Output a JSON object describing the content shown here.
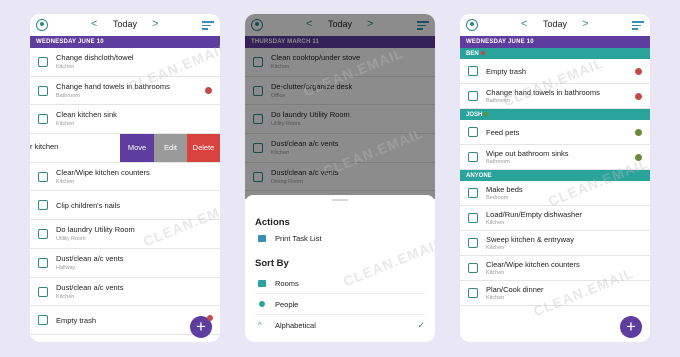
{
  "watermark": "CLEAN.EMAIL",
  "phone1": {
    "nav": {
      "prev": "<",
      "title": "Today",
      "next": ">"
    },
    "date": "WEDNESDAY JUNE 10",
    "tasks_before": [
      {
        "name": "Change dishcloth/towel",
        "room": "Kitchen"
      },
      {
        "name": "Change hand towels in bathrooms",
        "room": "Bathroom"
      },
      {
        "name": "Clean kitchen sink",
        "room": "Kitchen"
      }
    ],
    "swipe_row": {
      "partial_text": "r kitchen",
      "move": "Move",
      "edit": "Edit",
      "delete": "Delete"
    },
    "tasks_after": [
      {
        "name": "Clear/Wipe kitchen counters",
        "room": "Kitchen"
      },
      {
        "name": "Clip children's nails",
        "room": ""
      },
      {
        "name": "Do laundry Utility Room",
        "room": "Utility Room"
      },
      {
        "name": "Dust/clean a/c vents",
        "room": "Hallway"
      },
      {
        "name": "Dust/clean a/c vents",
        "room": "Kitchen"
      },
      {
        "name": "Empty trash",
        "room": ""
      }
    ],
    "fab": "+"
  },
  "phone2": {
    "nav": {
      "prev": "<",
      "title": "Today",
      "next": ">"
    },
    "date": "THURSDAY MARCH 11",
    "tasks": [
      {
        "name": "Clean cooktop/under stove",
        "room": "Kitchen"
      },
      {
        "name": "De-clutter/organize desk",
        "room": "Office"
      },
      {
        "name": "Do laundry Utility Room",
        "room": "Utility Room"
      },
      {
        "name": "Dust/clean a/c vents",
        "room": "Kitchen"
      },
      {
        "name": "Dust/clean a/c vents",
        "room": "Dining Room"
      }
    ],
    "sheet": {
      "actions_title": "Actions",
      "print": "Print Task List",
      "sort_title": "Sort By",
      "rooms": "Rooms",
      "people": "People",
      "alphabetical": "Alphabetical",
      "check": "✓"
    }
  },
  "phone3": {
    "nav": {
      "prev": "<",
      "title": "Today",
      "next": ">"
    },
    "date": "WEDNESDAY JUNE 10",
    "groups": [
      {
        "label": "BEN",
        "tasks": [
          {
            "name": "Empty trash",
            "room": ""
          },
          {
            "name": "Change hand towels in bathrooms",
            "room": "Bathroom"
          }
        ]
      },
      {
        "label": "JOSH",
        "tasks": [
          {
            "name": "Feed pets",
            "room": ""
          },
          {
            "name": "Wipe out bathroom sinks",
            "room": "Bathroom"
          }
        ]
      },
      {
        "label": "ANYONE",
        "tasks": [
          {
            "name": "Make beds",
            "room": "Bedroom"
          },
          {
            "name": "Load/Run/Empty dishwasher",
            "room": "Kitchen"
          },
          {
            "name": "Sweep kitchen & entryway",
            "room": "Kitchen"
          },
          {
            "name": "Clear/Wipe kitchen counters",
            "room": "Kitchen"
          },
          {
            "name": "Plan/Cook dinner",
            "room": "Kitchen"
          }
        ]
      }
    ],
    "fab": "+"
  }
}
